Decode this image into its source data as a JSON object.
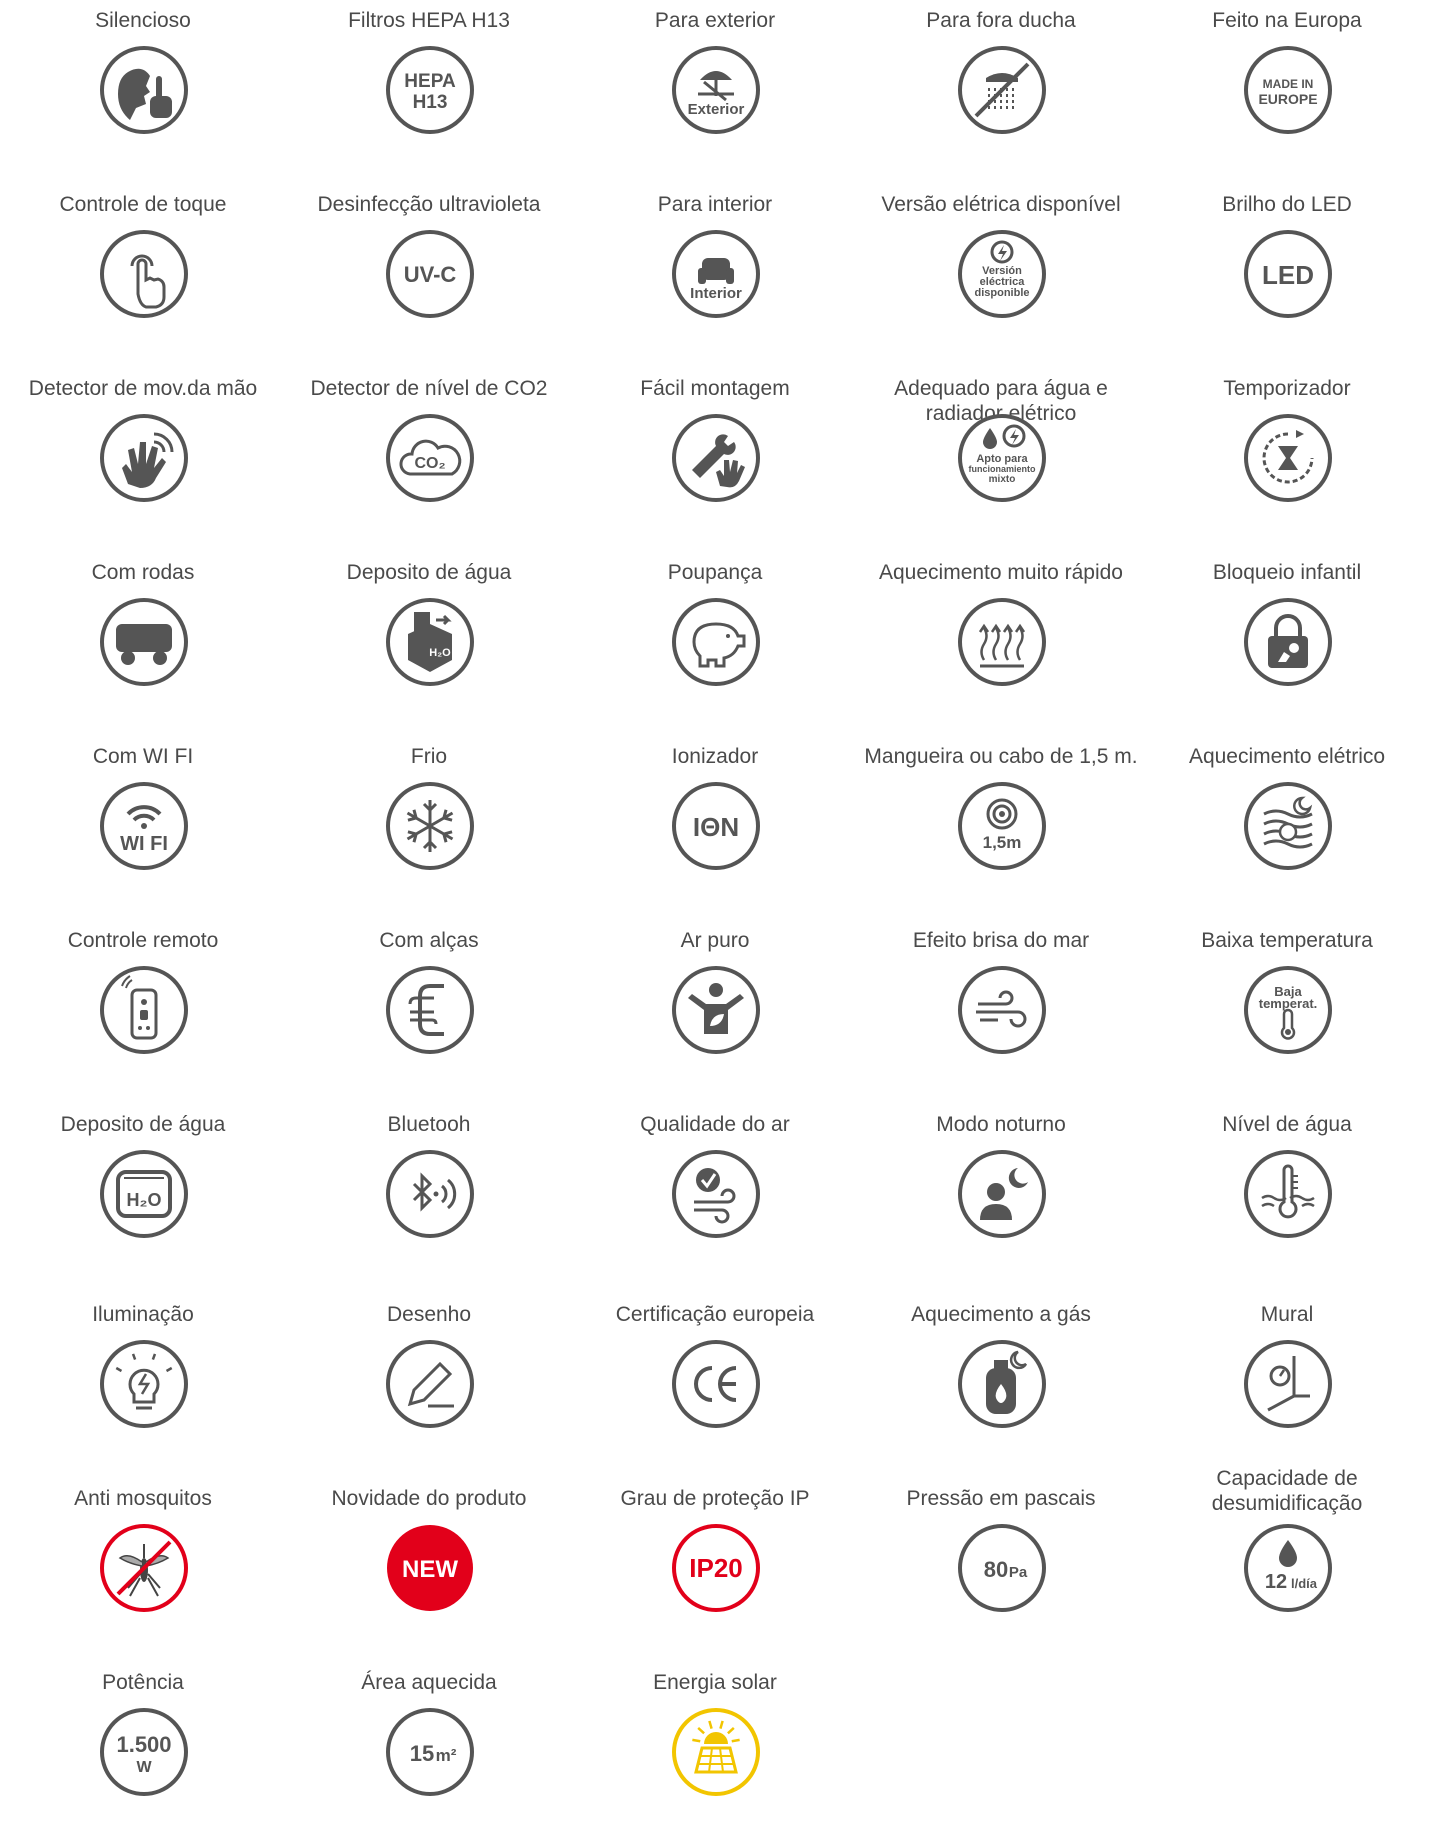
{
  "colors": {
    "gray": "#555555",
    "red": "#e2001a",
    "yellow": "#f2c500"
  },
  "items": [
    {
      "label": "Silencioso",
      "icon": "silent-icon"
    },
    {
      "label": "Filtros HEPA H13",
      "icon": "hepa-filter-icon",
      "text": [
        "HEPA",
        "H13"
      ]
    },
    {
      "label": "Para exterior",
      "icon": "outdoor-icon",
      "text": [
        "Exterior"
      ]
    },
    {
      "label": "Para fora ducha",
      "icon": "no-shower-icon"
    },
    {
      "label": "Feito na Europa",
      "icon": "made-in-europe-icon",
      "text": [
        "MADE IN",
        "EUROPE"
      ]
    },
    {
      "label": "Controle de toque",
      "icon": "touch-control-icon"
    },
    {
      "label": "Desinfecção ultravioleta",
      "icon": "uv-c-icon",
      "text": [
        "UV-C"
      ]
    },
    {
      "label": "Para interior",
      "icon": "indoor-icon",
      "text": [
        "Interior"
      ]
    },
    {
      "label": "Versão elétrica disponível",
      "icon": "electric-version-icon",
      "text": [
        "Versión",
        "eléctrica",
        "disponible"
      ]
    },
    {
      "label": "Brilho do LED",
      "icon": "led-icon",
      "text": [
        "LED"
      ]
    },
    {
      "label": "Detector de mov.da mão",
      "icon": "hand-motion-icon"
    },
    {
      "label": "Detector de nível de CO2",
      "icon": "co2-cloud-icon",
      "text": [
        "CO₂"
      ]
    },
    {
      "label": "Fácil montagem",
      "icon": "easy-assembly-icon"
    },
    {
      "label": "Adequado para água e radiador elétrico",
      "icon": "mixed-operation-icon",
      "text": [
        "Apto para",
        "funcionamiento",
        "mixto"
      ]
    },
    {
      "label": "Temporizador",
      "icon": "timer-icon"
    },
    {
      "label": "Com rodas",
      "icon": "wheels-icon"
    },
    {
      "label": "Deposito de água",
      "icon": "water-tank-box-icon",
      "text": [
        "H₂O"
      ]
    },
    {
      "label": "Poupança",
      "icon": "piggy-bank-icon"
    },
    {
      "label": "Aquecimento muito rápido",
      "icon": "fast-heating-icon"
    },
    {
      "label": "Bloqueio infantil",
      "icon": "child-lock-icon"
    },
    {
      "label": "Com WI FI",
      "icon": "wifi-icon",
      "text": [
        "WI FI"
      ]
    },
    {
      "label": "Frio",
      "icon": "snowflake-icon"
    },
    {
      "label": "Ionizador",
      "icon": "ionizer-icon",
      "text": [
        "IΘN"
      ]
    },
    {
      "label": "Mangueira ou cabo de 1,5 m.",
      "icon": "hose-cable-icon",
      "text": [
        "1,5m"
      ]
    },
    {
      "label": "Aquecimento elétrico",
      "icon": "electric-heating-icon"
    },
    {
      "label": "Controle remoto",
      "icon": "remote-control-icon"
    },
    {
      "label": "Com alças",
      "icon": "handle-icon"
    },
    {
      "label": "Ar puro",
      "icon": "pure-air-icon"
    },
    {
      "label": "Efeito brisa do mar",
      "icon": "sea-breeze-icon"
    },
    {
      "label": "Baixa temperatura",
      "icon": "low-temperature-icon",
      "text": [
        "Baja",
        "temperat."
      ]
    },
    {
      "label": "Deposito de água",
      "icon": "water-tank-icon",
      "text": [
        "H₂O"
      ]
    },
    {
      "label": "Bluetooh",
      "icon": "bluetooth-icon"
    },
    {
      "label": "Qualidade do ar",
      "icon": "air-quality-icon"
    },
    {
      "label": "Modo noturno",
      "icon": "night-mode-icon"
    },
    {
      "label": "Nível de água",
      "icon": "water-level-icon"
    },
    {
      "label": "Iluminação",
      "icon": "lighting-bulb-icon"
    },
    {
      "label": "Desenho",
      "icon": "design-pencil-icon"
    },
    {
      "label": "Certificação europeia",
      "icon": "ce-mark-icon",
      "text": [
        "CE"
      ]
    },
    {
      "label": "Aquecimento a gás",
      "icon": "gas-heating-icon"
    },
    {
      "label": "Mural",
      "icon": "wall-mount-icon"
    },
    {
      "label": "Anti mosquitos",
      "icon": "anti-mosquito-icon",
      "color": "#e2001a"
    },
    {
      "label": "Novidade do produto",
      "icon": "new-badge-icon",
      "text": [
        "NEW"
      ],
      "color": "#e2001a"
    },
    {
      "label": "Grau de proteção IP",
      "icon": "ip20-icon",
      "text": [
        "IP20"
      ],
      "color": "#e2001a"
    },
    {
      "label": "Pressão em pascais",
      "icon": "pressure-pa-icon",
      "text": [
        "80",
        "Pa"
      ]
    },
    {
      "label": "Capacidade de desumidificação",
      "icon": "dehumidification-icon",
      "text": [
        "12",
        "l/día"
      ]
    },
    {
      "label": "Potência",
      "icon": "power-icon",
      "text": [
        "1.500",
        "W"
      ]
    },
    {
      "label": "Área aquecida",
      "icon": "heated-area-icon",
      "text": [
        "15",
        "m²"
      ]
    },
    {
      "label": "Energia solar",
      "icon": "solar-energy-icon",
      "color": "#f2c500"
    }
  ]
}
